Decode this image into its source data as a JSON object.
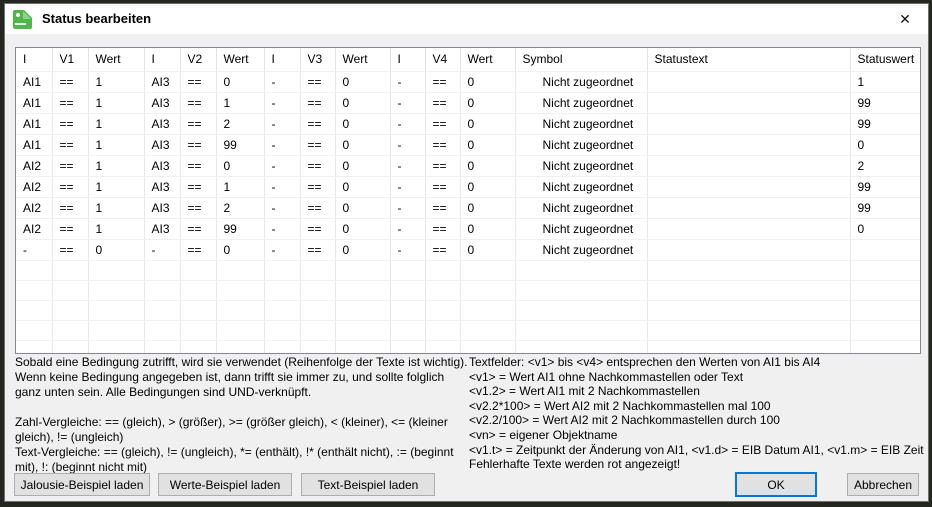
{
  "window": {
    "title": "Status bearbeiten",
    "close_glyph": "✕"
  },
  "table": {
    "columns": [
      "I",
      "V1",
      "Wert",
      "I",
      "V2",
      "Wert",
      "I",
      "V3",
      "Wert",
      "I",
      "V4",
      "Wert",
      "Symbol",
      "Statustext",
      "Statuswert"
    ],
    "rows": [
      [
        "AI1",
        "==",
        "1",
        "AI3",
        "==",
        "0",
        "-",
        "==",
        "0",
        "-",
        "==",
        "0",
        "Nicht zugeordnet",
        "",
        "1"
      ],
      [
        "AI1",
        "==",
        "1",
        "AI3",
        "==",
        "1",
        "-",
        "==",
        "0",
        "-",
        "==",
        "0",
        "Nicht zugeordnet",
        "",
        "99"
      ],
      [
        "AI1",
        "==",
        "1",
        "AI3",
        "==",
        "2",
        "-",
        "==",
        "0",
        "-",
        "==",
        "0",
        "Nicht zugeordnet",
        "",
        "99"
      ],
      [
        "AI1",
        "==",
        "1",
        "AI3",
        "==",
        "99",
        "-",
        "==",
        "0",
        "-",
        "==",
        "0",
        "Nicht zugeordnet",
        "",
        "0"
      ],
      [
        "AI2",
        "==",
        "1",
        "AI3",
        "==",
        "0",
        "-",
        "==",
        "0",
        "-",
        "==",
        "0",
        "Nicht zugeordnet",
        "",
        "2"
      ],
      [
        "AI2",
        "==",
        "1",
        "AI3",
        "==",
        "1",
        "-",
        "==",
        "0",
        "-",
        "==",
        "0",
        "Nicht zugeordnet",
        "",
        "99"
      ],
      [
        "AI2",
        "==",
        "1",
        "AI3",
        "==",
        "2",
        "-",
        "==",
        "0",
        "-",
        "==",
        "0",
        "Nicht zugeordnet",
        "",
        "99"
      ],
      [
        "AI2",
        "==",
        "1",
        "AI3",
        "==",
        "99",
        "-",
        "==",
        "0",
        "-",
        "==",
        "0",
        "Nicht zugeordnet",
        "",
        "0"
      ],
      [
        "-",
        "==",
        "0",
        "-",
        "==",
        "0",
        "-",
        "==",
        "0",
        "-",
        "==",
        "0",
        "Nicht zugeordnet",
        "",
        ""
      ]
    ],
    "empty_rows": 6
  },
  "help_left": {
    "p1": "Sobald eine Bedingung zutrifft, wird sie verwendet (Reihenfolge der Texte ist wichtig). Wenn keine Bedingung angegeben ist, dann trifft sie immer zu, und sollte folglich ganz unten sein. Alle Bedingungen sind UND-verknüpft.",
    "p2": "Zahl-Vergleiche: == (gleich), > (größer), >= (größer gleich), < (kleiner), <= (kleiner gleich), != (ungleich)",
    "p3": "Text-Vergleiche: == (gleich), != (ungleich), *= (enthält), !* (enthält nicht), := (beginnt mit), !: (beginnt nicht mit)"
  },
  "help_right": [
    "Textfelder: <v1> bis <v4> entsprechen den Werten von AI1 bis AI4",
    "<v1> = Wert AI1 ohne Nachkommastellen oder Text",
    "<v1.2> = Wert AI1 mit 2 Nachkommastellen",
    "<v2.2*100> = Wert AI2 mit 2 Nachkommastellen mal 100",
    "<v2.2/100> = Wert AI2 mit 2 Nachkommastellen durch 100",
    "<vn> = eigener Objektname",
    "<v1.t> = Zeitpunkt der Änderung von AI1, <v1.d> = EIB Datum AI1, <v1.m> = EIB Zeit",
    "Fehlerhafte Texte werden rot angezeigt!"
  ],
  "buttons": {
    "jalousie": "Jalousie-Beispiel laden",
    "werte": "Werte-Beispiel laden",
    "text": "Text-Beispiel laden",
    "ok": "OK",
    "abbrechen": "Abbrechen"
  },
  "colors": {
    "accent_blue": "#0078d7",
    "icon_green": "#4eb748",
    "dialog_background": "#f0f0f0",
    "titlebar_background": "#ffffff"
  }
}
